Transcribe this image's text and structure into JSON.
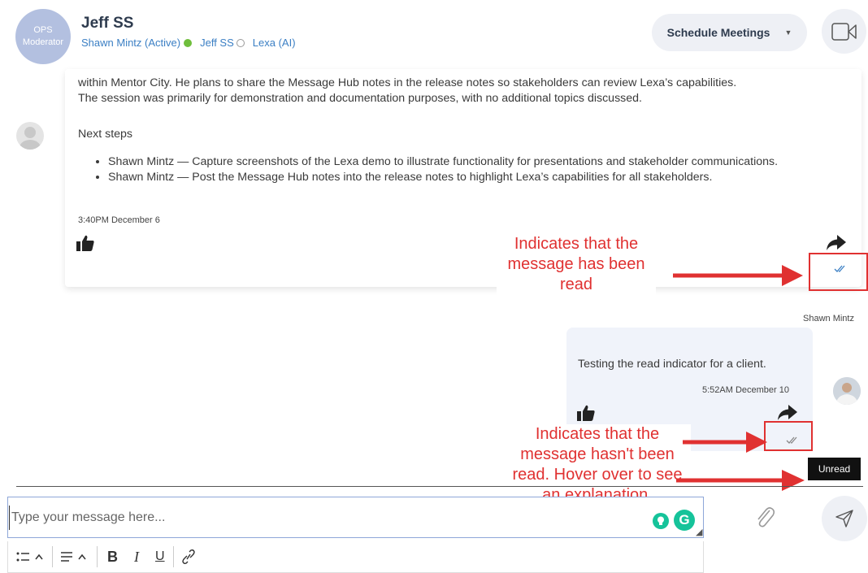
{
  "header": {
    "avatar_line1": "OPS",
    "avatar_line2": "Moderator",
    "chat_title": "Jeff SS",
    "participants": [
      {
        "name": "Shawn Mintz (Active)",
        "status": "online"
      },
      {
        "name": "Jeff SS",
        "status": "offline"
      },
      {
        "name": "Lexa (AI)",
        "status": ""
      }
    ],
    "schedule_label": "Schedule Meetings"
  },
  "message1": {
    "line1": "within Mentor City. He plans to share the Message Hub notes in the release notes so stakeholders can review Lexa’s capabilities.",
    "line2": "The session was primarily for demonstration and documentation purposes, with no additional topics discussed.",
    "next_steps_label": "Next steps",
    "steps": [
      "Shawn Mintz — Capture screenshots of the Lexa demo to illustrate functionality for presentations and stakeholder communications.",
      "Shawn Mintz — Post the Message Hub notes into the release notes to highlight Lexa’s capabilities for all stakeholders."
    ],
    "timestamp": "3:40PM December 6"
  },
  "message2": {
    "sender": "Shawn Mintz",
    "text": "Testing the read indicator for a client.",
    "timestamp": "5:52AM December 10",
    "tooltip": "Unread"
  },
  "annotations": {
    "read": "Indicates that the message has been read",
    "unread": "Indicates that the message hasn't been read. Hover over to see an explanation."
  },
  "composer": {
    "placeholder": "Type your message here...",
    "grammarly_letter": "G"
  },
  "colors": {
    "annotation": "#e03131",
    "read_check": "#3b7fc4",
    "unread_check": "#888888",
    "online": "#6fbe3c",
    "link": "#3b7fc4"
  },
  "icons": [
    "video-camera-icon",
    "thumbs-up-icon",
    "forward-icon",
    "double-check-icon",
    "paperclip-icon",
    "send-icon",
    "bullet-list-icon",
    "align-icon",
    "bold-icon",
    "italic-icon",
    "underline-icon",
    "link-icon",
    "lightbulb-icon",
    "grammarly-icon"
  ]
}
